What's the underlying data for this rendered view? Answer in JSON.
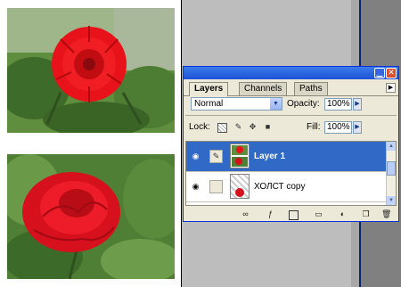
{
  "palette": {
    "tabs": [
      {
        "label": "Layers",
        "active": true
      },
      {
        "label": "Channels",
        "active": false
      },
      {
        "label": "Paths",
        "active": false
      }
    ],
    "blend_mode": "Normal",
    "opacity_label": "Opacity:",
    "opacity_value": "100%",
    "lock_label": "Lock:",
    "fill_label": "Fill:",
    "fill_value": "100%",
    "layers": [
      {
        "name": "Layer 1",
        "selected": true,
        "visible": true
      },
      {
        "name": "ХОЛСТ copy",
        "selected": false,
        "visible": true
      }
    ],
    "icons": [
      "eye-icon",
      "brush-icon",
      "link-layers-icon",
      "layer-style-icon",
      "add-mask-icon",
      "new-group-icon",
      "adjustment-layer-icon",
      "new-layer-icon",
      "trash-icon"
    ]
  },
  "colors": {
    "selection": "#3169c6",
    "titlebar": "#1c52d6",
    "rose": "#e8121a"
  }
}
